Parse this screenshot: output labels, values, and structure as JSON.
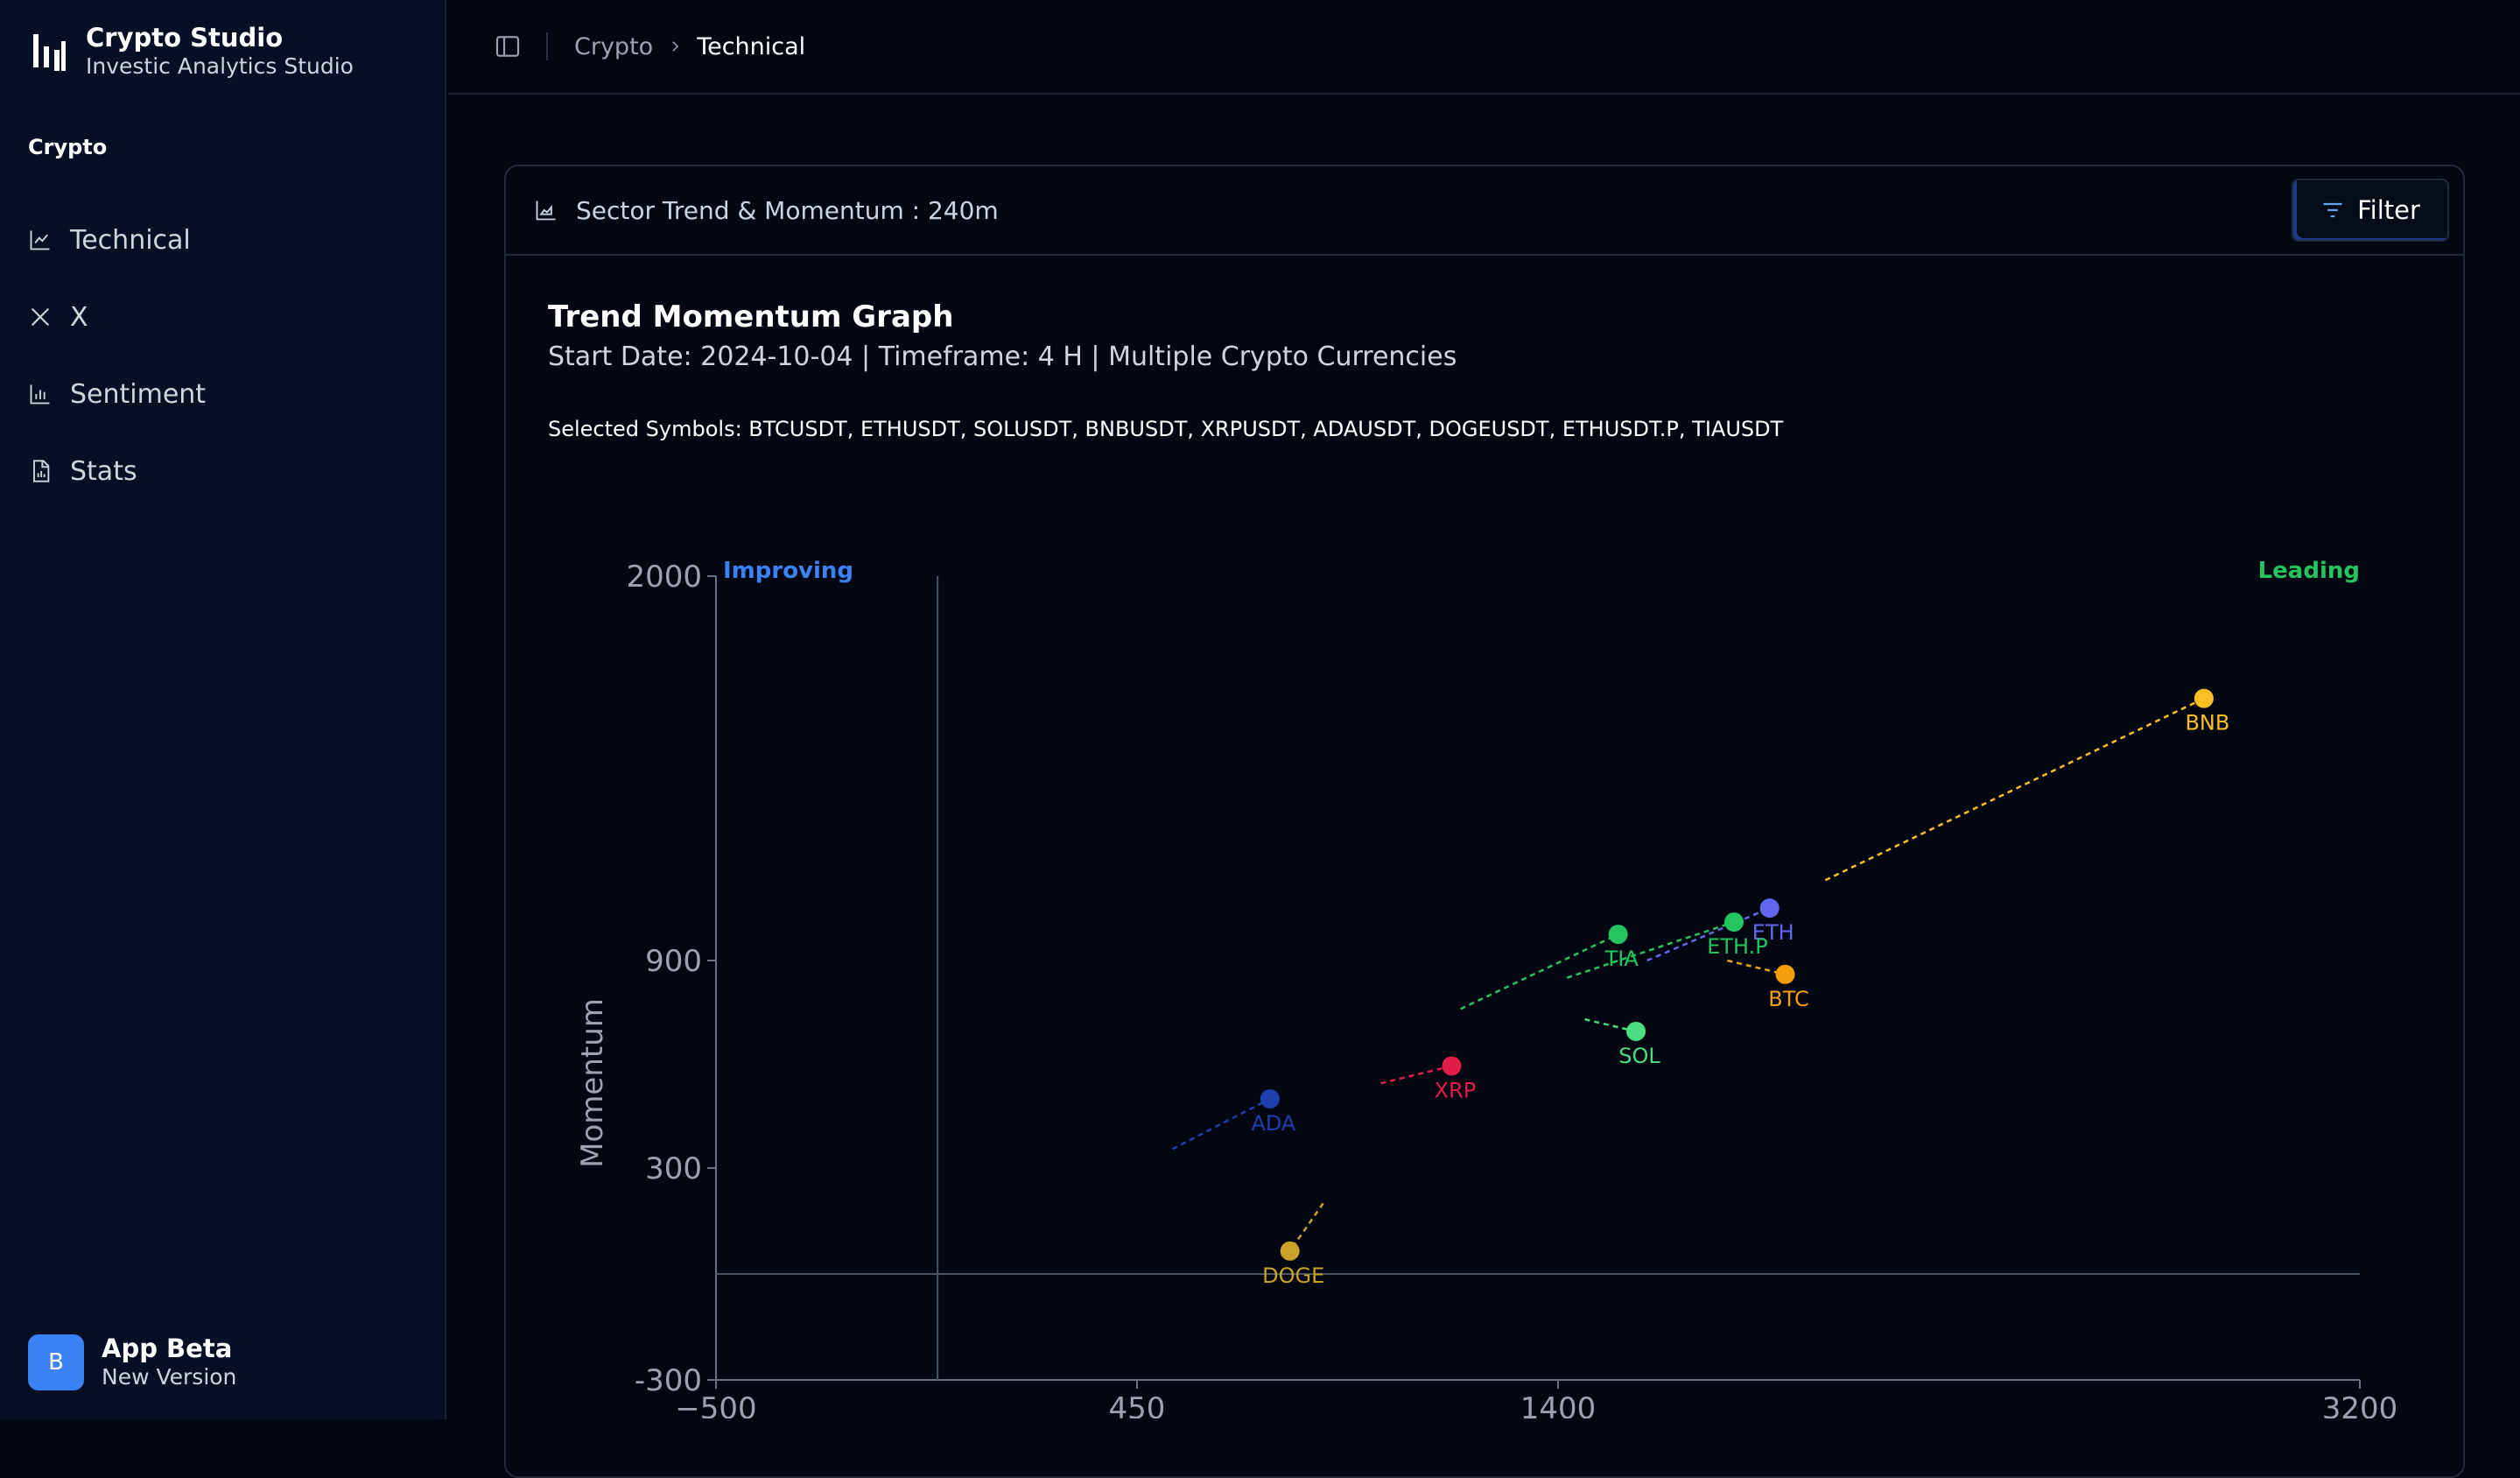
{
  "sidebar": {
    "brand_title": "Crypto Studio",
    "brand_subtitle": "Investic Analytics Studio",
    "group_label": "Crypto",
    "items": [
      {
        "label": "Technical",
        "icon": "line-chart-icon"
      },
      {
        "label": "X",
        "icon": "x-logo-icon"
      },
      {
        "label": "Sentiment",
        "icon": "bar-chart-icon"
      },
      {
        "label": "Stats",
        "icon": "file-chart-icon"
      }
    ],
    "user": {
      "initial": "B",
      "name": "App Beta",
      "subtitle": "New Version"
    }
  },
  "header": {
    "breadcrumb": [
      "Crypto",
      "Technical"
    ]
  },
  "card": {
    "title": "Sector Trend & Momentum : 240m",
    "filter_label": "Filter",
    "graph_title": "Trend Momentum Graph",
    "graph_subtitle": "Start Date: 2024-10-04 | Timeframe: 4 H | Multiple Crypto Currencies",
    "selected_symbols": "Selected Symbols: BTCUSDT, ETHUSDT, SOLUSDT, BNBUSDT, XRPUSDT, ADAUSDT, DOGEUSDT, ETHUSDT.P, TIAUSDT"
  },
  "chart_data": {
    "type": "scatter",
    "ylabel": "Momentum",
    "xlabel": "",
    "quadrant_labels": {
      "improving": "Improving",
      "leading": "Leading"
    },
    "x_ticks": [
      -500,
      450,
      1400,
      3200
    ],
    "y_ticks": [
      -300,
      300,
      900,
      2000
    ],
    "xlim": [
      -500,
      3200
    ],
    "ylim": [
      -300,
      2000
    ],
    "colors": {
      "improving": "#3b82f6",
      "leading": "#22c55e",
      "axis": "#9ca3af"
    },
    "series": [
      {
        "name": "BNB",
        "x": 2850,
        "y": 1650,
        "tail": [
          2000,
          1130
        ],
        "color": "#fbbf24"
      },
      {
        "name": "ETH",
        "x": 1875,
        "y": 1050,
        "tail": [
          1600,
          900
        ],
        "color": "#6366f1"
      },
      {
        "name": "ETH.P",
        "x": 1795,
        "y": 1010,
        "tail": [
          1420,
          850
        ],
        "color": "#22c55e"
      },
      {
        "name": "TIA",
        "x": 1535,
        "y": 975,
        "tail": [
          1180,
          760
        ],
        "color": "#22c55e"
      },
      {
        "name": "BTC",
        "x": 1910,
        "y": 860,
        "tail": [
          1780,
          900
        ],
        "color": "#f59e0b"
      },
      {
        "name": "SOL",
        "x": 1575,
        "y": 695,
        "tail": [
          1460,
          730
        ],
        "color": "#4ade80"
      },
      {
        "name": "XRP",
        "x": 1160,
        "y": 595,
        "tail": [
          1000,
          545
        ],
        "color": "#e11d48"
      },
      {
        "name": "ADA",
        "x": 750,
        "y": 500,
        "tail": [
          530,
          355
        ],
        "color": "#1e40af"
      },
      {
        "name": "DOGE",
        "x": 795,
        "y": 65,
        "tail": [
          870,
          200
        ],
        "color": "#c9a227"
      }
    ]
  }
}
